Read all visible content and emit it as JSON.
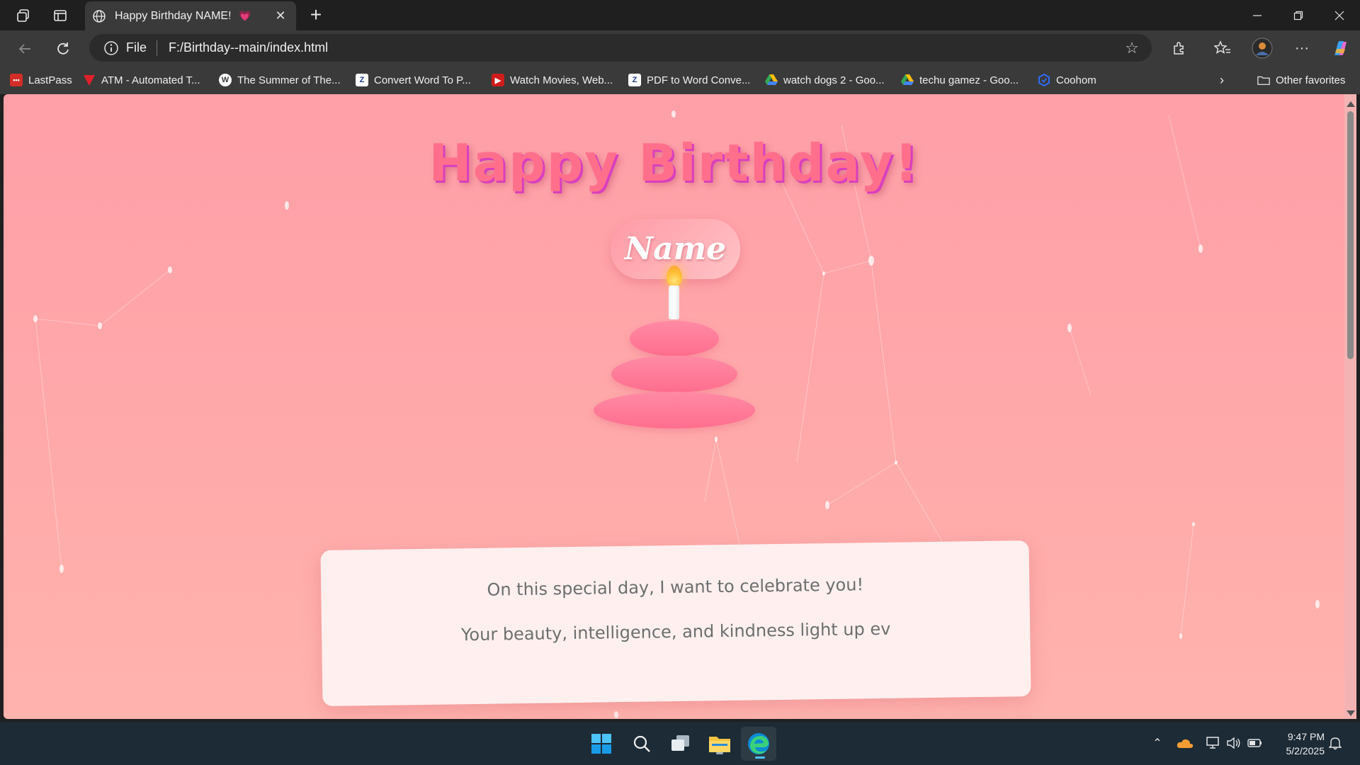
{
  "browser": {
    "tab": {
      "title": "Happy Birthday NAME!",
      "emoji": "💗"
    },
    "address": {
      "scheme": "File",
      "url": "F:/Birthday--main/index.html"
    },
    "favorites": [
      {
        "label": "LastPass",
        "icon": "lastpass-icon",
        "color": "#d32d27"
      },
      {
        "label": "ATM - Automated T...",
        "icon": "atm-icon",
        "color": "#e0202a"
      },
      {
        "label": "The Summer of The...",
        "icon": "wordpress-icon",
        "color": "#ffffff"
      },
      {
        "label": "Convert Word To P...",
        "icon": "zamzar-icon",
        "color": "#f0c419"
      },
      {
        "label": "Watch Movies, Web...",
        "icon": "movies-icon",
        "color": "#d01b1b"
      },
      {
        "label": "PDF to Word Conve...",
        "icon": "zamzar-icon",
        "color": "#f0c419"
      },
      {
        "label": "watch dogs 2 - Goo...",
        "icon": "google-drive-icon",
        "color": "#34a853"
      },
      {
        "label": "techu gamez - Goo...",
        "icon": "google-drive-icon",
        "color": "#34a853"
      },
      {
        "label": "Coohom",
        "icon": "coohom-icon",
        "color": "#2f6cf6"
      }
    ],
    "other_favorites": "Other favorites"
  },
  "page": {
    "headline": "Happy Birthday!",
    "name": "Name",
    "message_line1": "On this special day, I want to celebrate you!",
    "message_line2": "Your beauty, intelligence, and kindness light up ev",
    "colors": {
      "background": "#ffa7aa",
      "headline": "#ff6f8c",
      "headline_shadow": "#d93fbe",
      "cake": "#ff7a96"
    }
  },
  "taskbar": {
    "clock_time": "9:47 PM",
    "clock_date": "5/2/2025"
  }
}
